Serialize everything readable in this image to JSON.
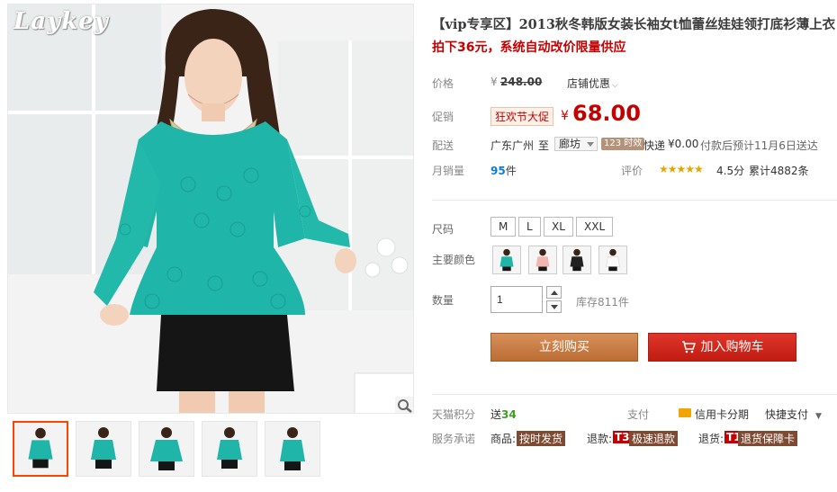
{
  "gallery": {
    "logo": "Laykey",
    "thumbnails": [
      "thumb-1",
      "thumb-2",
      "thumb-3",
      "thumb-4",
      "thumb-5"
    ],
    "zoom_icon": "magnifier-icon"
  },
  "product": {
    "title": "【vip专享区】2013秋冬韩版女装长袖女t恤蕾丝娃娃领打底衫薄上衣",
    "subtitle": "拍下36元，系统自动改价限量供应"
  },
  "price": {
    "label": "价格",
    "currency": "¥",
    "original": "248.00",
    "store_discount": "店铺优惠"
  },
  "promo": {
    "label": "促销",
    "tag": "狂欢节大促",
    "currency": "¥",
    "price": "68.00"
  },
  "shipping": {
    "label": "配送",
    "from": "广东广州",
    "to_word": "至",
    "destination": "廊坊",
    "days_badge": "123 时效",
    "method": "快递",
    "fee": "¥0.00",
    "eta": "付款后预计11月6日送达"
  },
  "sales": {
    "label": "月销量",
    "count": "95",
    "unit": "件",
    "rating_label": "评价",
    "rating": "4.5分",
    "reviews": "累计4882条"
  },
  "options": {
    "size_label": "尺码",
    "sizes": [
      "M",
      "L",
      "XL",
      "XXL"
    ],
    "color_label": "主要颜色",
    "colors": [
      "teal",
      "pink",
      "black",
      "white"
    ]
  },
  "quantity": {
    "label": "数量",
    "value": "1",
    "stock": "库存811件"
  },
  "actions": {
    "buy_now": "立刻购买",
    "add_to_cart": "加入购物车"
  },
  "footer": {
    "points_label": "天猫积分",
    "points_prefix": "送",
    "points_value": "34",
    "pay_label": "支付",
    "credit_card": "信用卡分期",
    "quick_pay": "快捷支付",
    "service_label": "服务承诺",
    "goods_label": "商品:",
    "goods_tag": "按时发货",
    "refund_label": "退款:",
    "refund_code": "T3",
    "refund_tag": "极速退款",
    "return_label": "退货:",
    "return_code": "T1",
    "return_tag": "退货保障卡"
  },
  "colors": {
    "accent_red": "#c40000",
    "buy_orange": "#c77a40",
    "cart_red": "#d42a20",
    "blouse_teal": "#1fb5a8"
  }
}
